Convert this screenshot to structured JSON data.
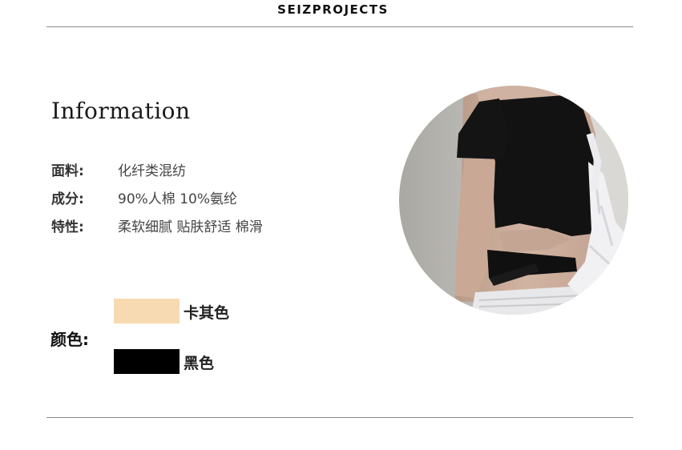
{
  "header": {
    "brand": "SEIZPROJECTS"
  },
  "info": {
    "title": "Information",
    "specs": [
      {
        "label": "面料:",
        "value": "化纤类混纺"
      },
      {
        "label": "成分:",
        "value": "90%人棉 10%氨纶"
      },
      {
        "label": "特性:",
        "value": "柔软细腻 贴肤舒适 棉滑"
      }
    ]
  },
  "colors": {
    "label": "颜色:",
    "options": [
      {
        "name": "卡其色",
        "swatch": "#f7dab2"
      },
      {
        "name": "黑色",
        "swatch": "#000000"
      }
    ]
  },
  "photo": {
    "subject": "model-back-view-black-crop-top-icon"
  }
}
